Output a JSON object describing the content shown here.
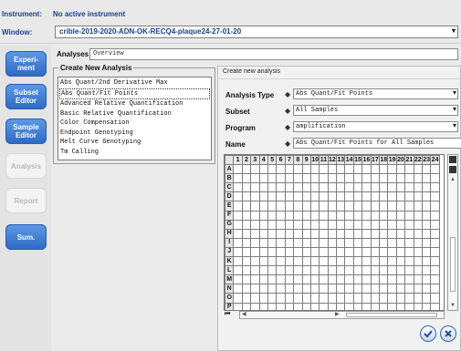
{
  "header": {
    "instrument_label": "Instrument:",
    "instrument_value": "No active instrument",
    "window_label": "Window:",
    "window_value": "crible-2019-2020-ADN-OK-RECQ4-plaque24-27-01-20"
  },
  "sidebar": {
    "items": [
      {
        "label": "Experi-\nment",
        "state": "active"
      },
      {
        "label": "Subset\nEditor",
        "state": "active"
      },
      {
        "label": "Sample\nEditor",
        "state": "active"
      },
      {
        "label": "Analysis",
        "state": "disabled"
      },
      {
        "label": "Report",
        "state": "disabled"
      },
      {
        "label": "Sum.",
        "state": "active"
      }
    ]
  },
  "analyses": {
    "label": "Analyses",
    "value": "Overview"
  },
  "create_panel": {
    "title": "Create New Analysis",
    "items": [
      "Abs Quant/2nd Derivative Max",
      "Abs Quant/Fit Points",
      "Advanced Relative Quantification",
      "Basic Relative Quantification",
      "Color Compensation",
      "Endpoint Genotyping",
      "Melt Curve Genotyping",
      "Tm Calling"
    ],
    "selected_index": 1
  },
  "dialog": {
    "title": "Create new analysis",
    "fields": [
      {
        "label": "Analysis Type",
        "value": "Abs Quant/Fit Points",
        "required": "◆",
        "dropdown": true
      },
      {
        "label": "Subset",
        "value": "All Samples",
        "required": "◆",
        "dropdown": true
      },
      {
        "label": "Program",
        "value": "amplification",
        "required": "◆",
        "dropdown": true
      },
      {
        "label": "Name",
        "value": "Abs Quant/Fit Points for All Samples",
        "required": "◆",
        "dropdown": false
      }
    ],
    "plate": {
      "columns": [
        "1",
        "2",
        "3",
        "4",
        "5",
        "6",
        "7",
        "8",
        "9",
        "10",
        "11",
        "12",
        "13",
        "14",
        "15",
        "16",
        "17",
        "18",
        "19",
        "20",
        "21",
        "22",
        "23",
        "24"
      ],
      "rows": [
        "A",
        "B",
        "C",
        "D",
        "E",
        "F",
        "G",
        "H",
        "I",
        "J",
        "K",
        "L",
        "M",
        "N",
        "O",
        "P"
      ]
    }
  },
  "icons": {
    "ok": "check-circle-icon",
    "cancel": "x-circle-icon"
  },
  "colors": {
    "accent_blue": "#2d68c4",
    "header_text": "#1b3f8f"
  }
}
